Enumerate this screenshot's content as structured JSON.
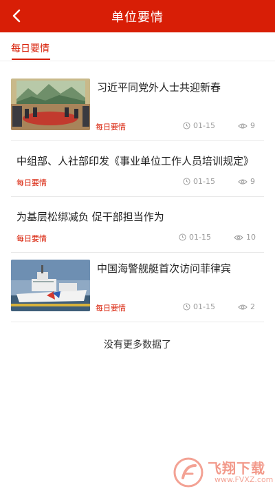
{
  "header": {
    "title": "单位要情",
    "background": "#d81e06"
  },
  "tabs": [
    {
      "label": "每日要情",
      "active": true
    }
  ],
  "articles": [
    {
      "title": "习近平同党外人士共迎新春",
      "category": "每日要情",
      "date": "01-15",
      "views": "9",
      "has_image": true,
      "image": "meeting-hall-photo"
    },
    {
      "title": "中组部、人社部印发《事业单位工作人员培训规定》",
      "category": "每日要情",
      "date": "01-15",
      "views": "9",
      "has_image": false
    },
    {
      "title": "为基层松绑减负 促干部担当作为",
      "category": "每日要情",
      "date": "01-15",
      "views": "10",
      "has_image": false
    },
    {
      "title": "中国海警舰艇首次访问菲律宾",
      "category": "每日要情",
      "date": "01-15",
      "views": "2",
      "has_image": true,
      "image": "coast-guard-ship-photo"
    }
  ],
  "footer_text": "没有更多数据了",
  "watermark": {
    "name": "飞翔下载",
    "url": "www.FVXZ.com"
  },
  "colors": {
    "accent": "#d81e06",
    "meta": "#999999"
  }
}
